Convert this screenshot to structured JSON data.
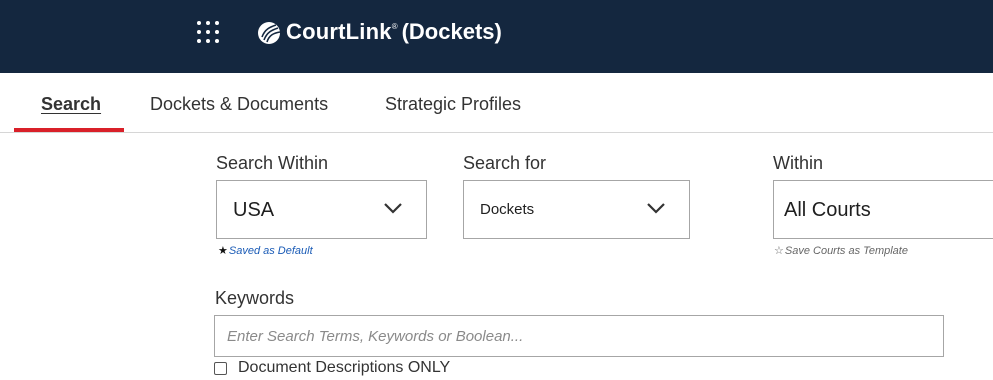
{
  "header": {
    "app_name": "CourtLink",
    "registered_mark": "®",
    "app_section": "(Dockets)"
  },
  "tabs": [
    {
      "label": "Search",
      "active": true
    },
    {
      "label": "Dockets & Documents",
      "active": false
    },
    {
      "label": "Strategic Profiles",
      "active": false
    }
  ],
  "search_within": {
    "label": "Search Within",
    "value": "USA",
    "hint_icon": "star-filled-icon",
    "hint_star": "★",
    "hint_text": "Saved as Default"
  },
  "search_for": {
    "label": "Search for",
    "value": "Dockets"
  },
  "within": {
    "label": "Within",
    "value": "All Courts",
    "hint_icon": "star-outline-icon",
    "hint_star": "☆",
    "hint_text": "Save Courts as Template"
  },
  "keywords": {
    "label": "Keywords",
    "value": "",
    "placeholder": "Enter Search Terms, Keywords or Boolean..."
  },
  "document_descriptions_only": {
    "label": "Document Descriptions ONLY",
    "checked": false
  },
  "colors": {
    "header_bg": "#14273f",
    "active_tab_underline": "#d92029",
    "link": "#1a5bb6"
  }
}
